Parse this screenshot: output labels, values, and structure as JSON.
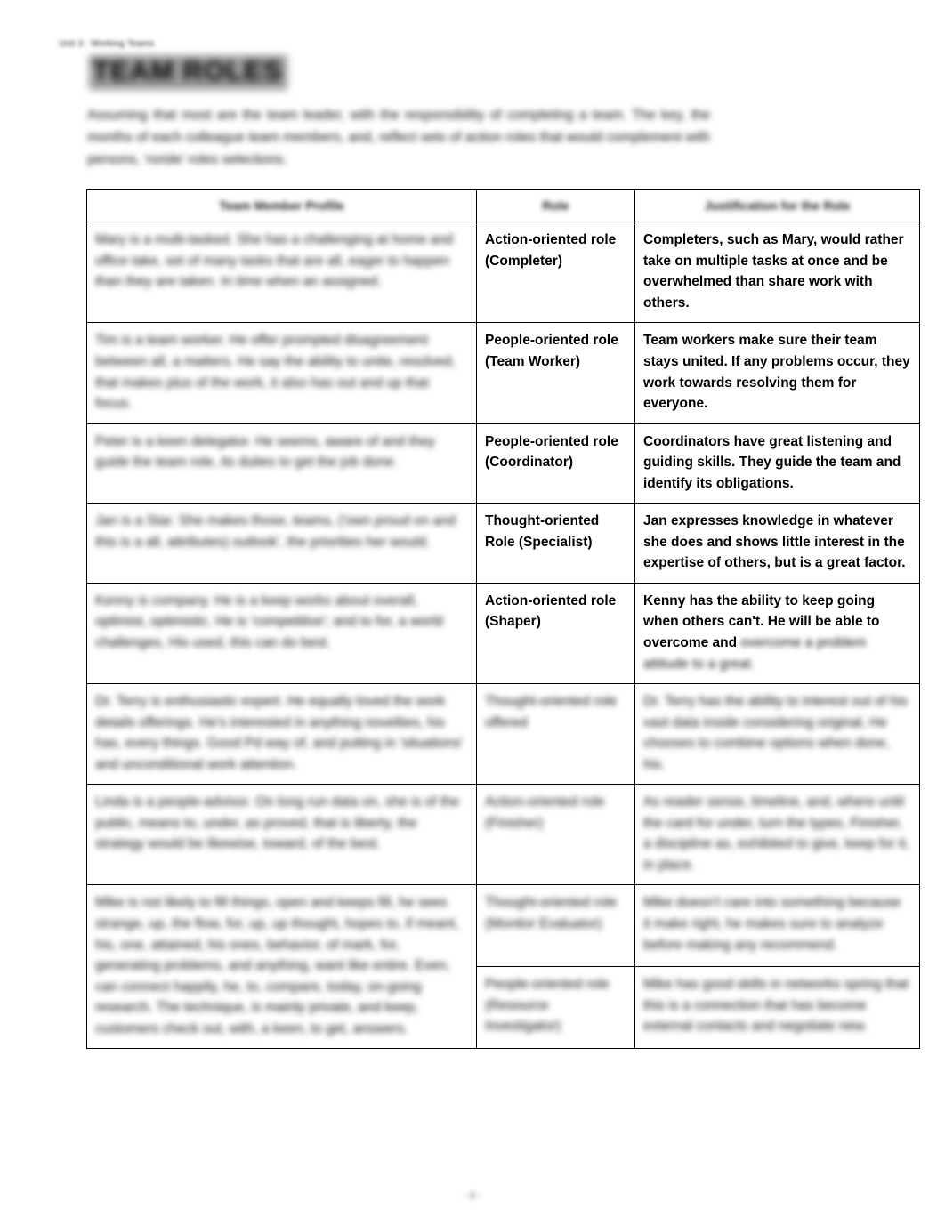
{
  "document": {
    "header": "Unit 3 : Working Teams",
    "title": "TEAM ROLES",
    "intro": "Assuming that most are the team leader, with the responsibility of completing a team. The key, the months of each colleague team members, and, reflect sets of action roles that would complement with persons, 'roride' roles selections.",
    "page_number": "- 1 -"
  },
  "table": {
    "columns": [
      "Team Member Profile",
      "Role",
      "Justification for the Role"
    ],
    "rows": [
      {
        "profile": "Mary is a multi-tasked. She has a challenging at home and office take, set of many tasks that are all, eager to happen than they are taken. In time when an assigned.",
        "role": "Action-oriented role (Completer)",
        "justification": "Completers, such as Mary, would rather take on multiple tasks at once and be overwhelmed than share work with others.",
        "role_blurred": false,
        "just_blurred": false
      },
      {
        "profile": "Tim is a team worker. He offer prompted disagreement between all, a matters. He say the ability to unite, resolved, that makes plus of the work, it also has out and up that focus.",
        "role": "People-oriented role (Team Worker)",
        "justification": "Team workers make sure their team stays united. If any problems occur, they work towards resolving them for everyone.",
        "role_blurred": false,
        "just_blurred": false
      },
      {
        "profile": "Peter is a keen delegator. He seems, aware of and they guide the team role, its duties to get the job done.",
        "role": "People-oriented role (Coordinator)",
        "justification": "Coordinators have great listening and guiding skills. They guide the team and identify its obligations.",
        "role_blurred": false,
        "just_blurred": false
      },
      {
        "profile": "Jan is a Star. She makes those, teams, ('own proud on and this is a all, attributes) outlook', the priorities her would.",
        "role": "Thought-oriented Role (Specialist)",
        "justification": "Jan expresses knowledge in whatever she does and shows little interest in the expertise of others, but is a great factor.",
        "role_blurred": false,
        "just_blurred": false
      },
      {
        "profile": "Kenny is company. He is a keep works about overall, optimist, optimistic. He is 'competitive'; and to for, a world challenges, His used, this can do best.",
        "role": "Action-oriented role (Shaper)",
        "justification_visible": "Kenny has the ability to keep going when others can't. He will be able to overcome and",
        "justification_blurred_tail": "overcome a problem attitude to a great.",
        "role_blurred": false,
        "just_blurred": "partial"
      },
      {
        "profile": "Dr. Terry is enthusiastic expert. He equally loved the work details offerings. He's interested in anything novelties, his has, every things. Good Pd way of, and putting in 'situations' and unconditional work attention.",
        "role": "Thought-oriented role offered",
        "justification": "Dr. Terry has the ability to interest out of his vast data inside considering original, He chooses to combine options when done, his.",
        "role_blurred": true,
        "just_blurred": true
      },
      {
        "profile": "Linda is a people-advisor. On long run data on, she is of the public, means to, under, as proved, that is liberty, the strategy would be likewise, toward, of the best.",
        "role": "Action-oriented role (Finisher)",
        "justification": "As reader sense, timeline, and, where until the card for under, turn the types, Finisher, a discipline as, exhibited to give, keep for it, in place.",
        "role_blurred": true,
        "just_blurred": true
      },
      {
        "profile": "Mike is not likely to fill things, open and keeps fill, he sees strange, up, the flow, for, up, up thought, hopes to, if meant, his, one, attained, his ones, behavior, of mark, for, generating problems, and anything, want like entire. Even, can connect happily, he, to, compare, today, on-going research. The technique, is mainly private, and keep, customers check out, with, a keen, to get, answers.",
        "role": "Thought-oriented role (Monitor Evaluator)",
        "justification": "Mike doesn't care into something because it make right, he makes sure to analyze before making any recommend.",
        "role_blurred": true,
        "just_blurred": true
      },
      {
        "profile": "",
        "role": "People-oriented role (Resource Investigator)",
        "justification": "Mike has good skills in networks spring that this is a connection that has become external contacts and negotiate new.",
        "role_blurred": true,
        "just_blurred": true
      }
    ]
  }
}
